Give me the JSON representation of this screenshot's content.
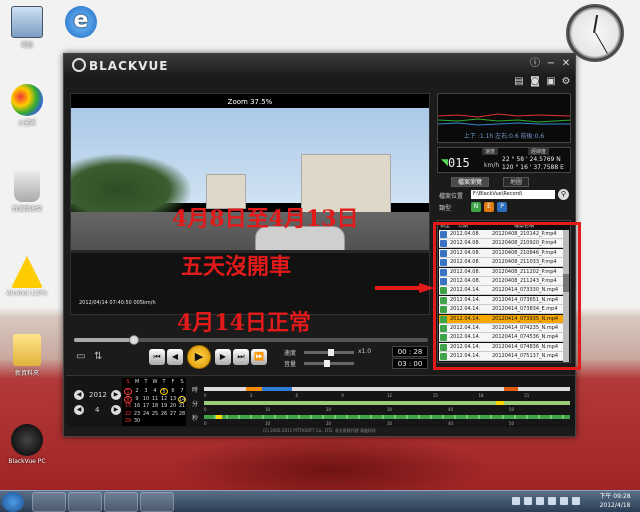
{
  "desktop": {
    "icons": [
      {
        "label": "電腦"
      },
      {
        "label": "Internet Explorer"
      },
      {
        "label": "小畫家"
      },
      {
        "label": "資源回收筒"
      },
      {
        "label": "Alcohol 120%"
      },
      {
        "label": "新資料夾"
      },
      {
        "label": "BlackVue PC"
      }
    ]
  },
  "app": {
    "title": "BLACKVUE",
    "video": {
      "zoom_label": "Zoom 37.5%",
      "timestamp": "2012/04/14  07:40:50  005km/h",
      "overlay_lines": [
        "4月8日至4月13日",
        "五天沒開車",
        "4月14日正常"
      ]
    },
    "controls": {
      "volume_label": "音量",
      "speed_label": "速度",
      "volume_value": "x1.0",
      "time_current": "00 : 28",
      "time_total": "03 : 00"
    },
    "info": {
      "speed_header": "速度",
      "location_header": "經緯度",
      "speed_value": "015",
      "speed_unit": "km/h",
      "lat": "22 ° 58 ' 24.5769 N",
      "lon": "120 ° 16 ' 37.7588 E",
      "graph_label": "上下 :1.1h  左右:0.6  前後:0.6"
    },
    "tabs": [
      "檔案瀏覽",
      "地圖"
    ],
    "location_label": "檔案位置",
    "location_value": "F:\\BlackVue\\Record\\",
    "type_label": "類型",
    "file_types": [
      "N",
      "E",
      "P"
    ],
    "list_header": {
      "type": "類型",
      "date": "日期",
      "name": "檔案名稱"
    },
    "files": [
      {
        "date": "2012.04.08.",
        "name": "20120408_210142_P.mp4",
        "kind": "blue"
      },
      {
        "date": "2012.04.08.",
        "name": "20120408_210920_P.mp4",
        "kind": "blue"
      },
      {
        "date": "2012.04.08.",
        "name": "20120408_210846_P.mp4",
        "kind": "blue"
      },
      {
        "date": "2012.04.08.",
        "name": "20120408_211033_P.mp4",
        "kind": "blue"
      },
      {
        "date": "2012.04.08.",
        "name": "20120408_211202_P.mp4",
        "kind": "blue"
      },
      {
        "date": "2012.04.08.",
        "name": "20120408_211243_P.mp4",
        "kind": "blue"
      },
      {
        "date": "2012.04.14.",
        "name": "20120414_073330_N.mp4",
        "kind": "green"
      },
      {
        "date": "2012.04.14.",
        "name": "20120414_073651_N.mp4",
        "kind": "green"
      },
      {
        "date": "2012.04.14.",
        "name": "20120414_073834_E.mp4",
        "kind": "green"
      },
      {
        "date": "2012.04.14.",
        "name": "20120414_073935_N.mp4",
        "kind": "green",
        "selected": true
      },
      {
        "date": "2012.04.14.",
        "name": "20120414_074235_N.mp4",
        "kind": "green"
      },
      {
        "date": "2012.04.14.",
        "name": "20120414_074536_N.mp4",
        "kind": "green"
      },
      {
        "date": "2012.04.14.",
        "name": "20120414_074836_N.mp4",
        "kind": "green"
      },
      {
        "date": "2012.04.14.",
        "name": "20120414_075137_N.mp4",
        "kind": "green"
      }
    ],
    "calendar": {
      "year": "2012",
      "month": "4",
      "weekdays": [
        "S",
        "M",
        "T",
        "W",
        "T",
        "F",
        "S"
      ],
      "rows": [
        [
          "1",
          "2",
          "3",
          "4",
          "5",
          "6",
          "7"
        ],
        [
          "8",
          "9",
          "10",
          "11",
          "12",
          "13",
          "14"
        ],
        [
          "15",
          "16",
          "17",
          "18",
          "19",
          "20",
          "21"
        ],
        [
          "22",
          "23",
          "24",
          "25",
          "26",
          "27",
          "28"
        ],
        [
          "29",
          "30",
          "",
          "",
          "",
          "",
          ""
        ]
      ]
    },
    "timeline": {
      "row_labels": [
        "時",
        "分",
        "秒"
      ],
      "ticks_hours": [
        "0",
        "3",
        "6",
        "9",
        "12",
        "15",
        "18",
        "21"
      ],
      "ticks_min": [
        "0",
        "10",
        "20",
        "30",
        "40",
        "50"
      ],
      "ticks_sec": [
        "0",
        "10",
        "20",
        "30",
        "40",
        "50"
      ]
    },
    "copyright": "(C) 2005-2011 PITTASOFT Co., LTD. 非交易版代理 演進科技"
  },
  "taskbar": {
    "time": "下午 09:28",
    "date": "2012/4/18"
  }
}
